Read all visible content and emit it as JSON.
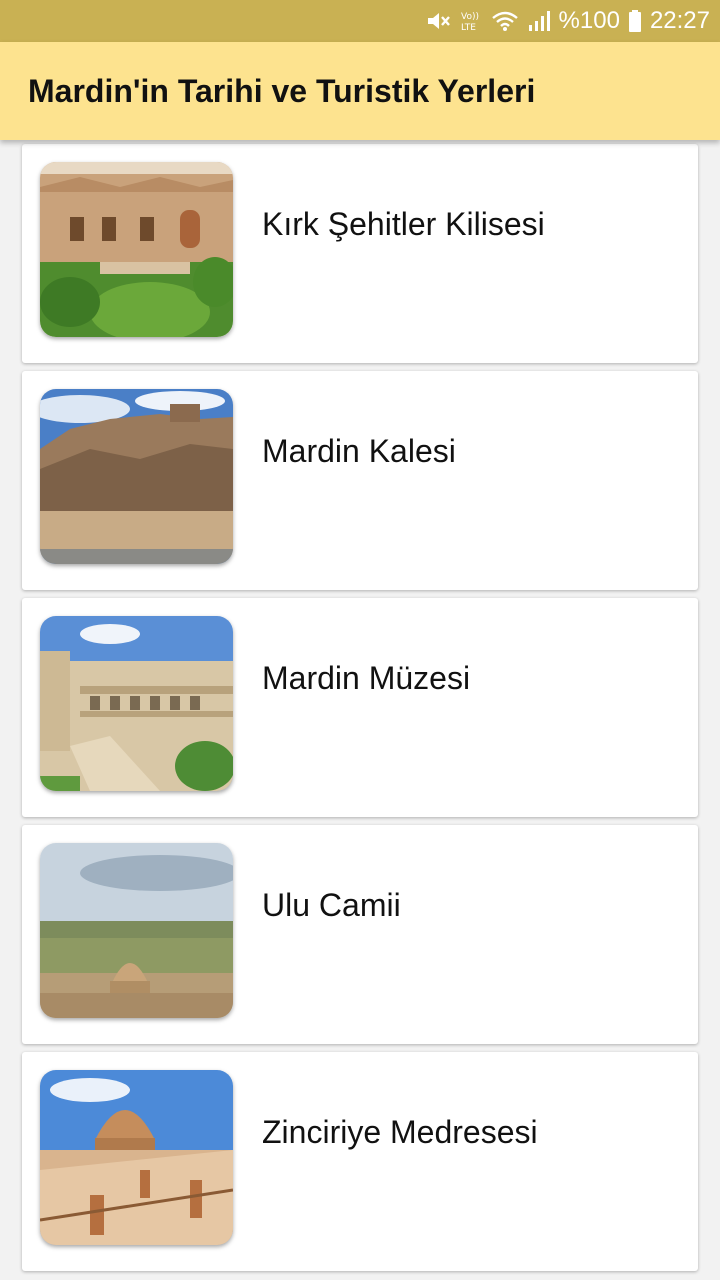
{
  "status_bar": {
    "battery": "%100",
    "time": "22:27",
    "icons": [
      "mute-icon",
      "volte-icon",
      "wifi-icon",
      "signal-icon",
      "battery-icon"
    ]
  },
  "app_bar": {
    "title": "Mardin'in Tarihi ve Turistik Yerleri",
    "color": "#fde38f"
  },
  "places": [
    {
      "name": "Kırk Şehitler Kilisesi"
    },
    {
      "name": "Mardin Kalesi"
    },
    {
      "name": "Mardin Müzesi"
    },
    {
      "name": "Ulu Camii"
    },
    {
      "name": "Zinciriye Medresesi"
    }
  ]
}
